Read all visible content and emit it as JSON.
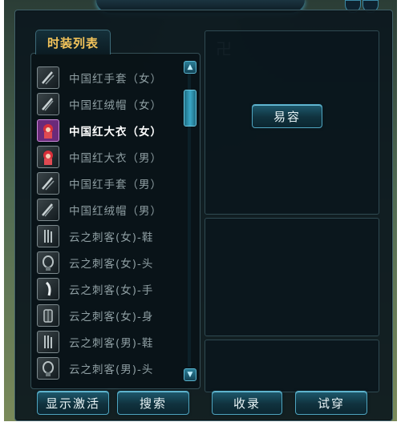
{
  "window": {
    "tab_label": "时装列表"
  },
  "fashion_list": {
    "items": [
      {
        "label": "中国红手套（女）",
        "icon": "glove-icon",
        "active": false
      },
      {
        "label": "中国红绒帽（女）",
        "icon": "hat-icon",
        "active": false
      },
      {
        "label": "中国红大衣（女）",
        "icon": "coat-icon",
        "active": true
      },
      {
        "label": "中国红大衣（男）",
        "icon": "coat-icon",
        "active": false
      },
      {
        "label": "中国红手套（男）",
        "icon": "glove-icon",
        "active": false
      },
      {
        "label": "中国红绒帽（男）",
        "icon": "hat-icon",
        "active": false
      },
      {
        "label": "云之刺客(女)-鞋",
        "icon": "shoes-icon",
        "active": false
      },
      {
        "label": "云之刺客(女)-头",
        "icon": "head-icon",
        "active": false
      },
      {
        "label": "云之刺客(女)-手",
        "icon": "hand-icon",
        "active": false
      },
      {
        "label": "云之刺客(女)-身",
        "icon": "body-icon",
        "active": false
      },
      {
        "label": "云之刺客(男)-鞋",
        "icon": "shoes-icon",
        "active": false
      },
      {
        "label": "云之刺客(男)-头",
        "icon": "head-icon",
        "active": false
      }
    ]
  },
  "buttons": {
    "makeover": "易容",
    "show_active": "显示激活",
    "search": "搜索",
    "collect": "收录",
    "try_on": "试穿"
  },
  "colors": {
    "tab_text": "#f2c35a",
    "accent": "#4fa5c0",
    "active_item": "#ffffff",
    "inactive_item": "#8f9fa3"
  }
}
